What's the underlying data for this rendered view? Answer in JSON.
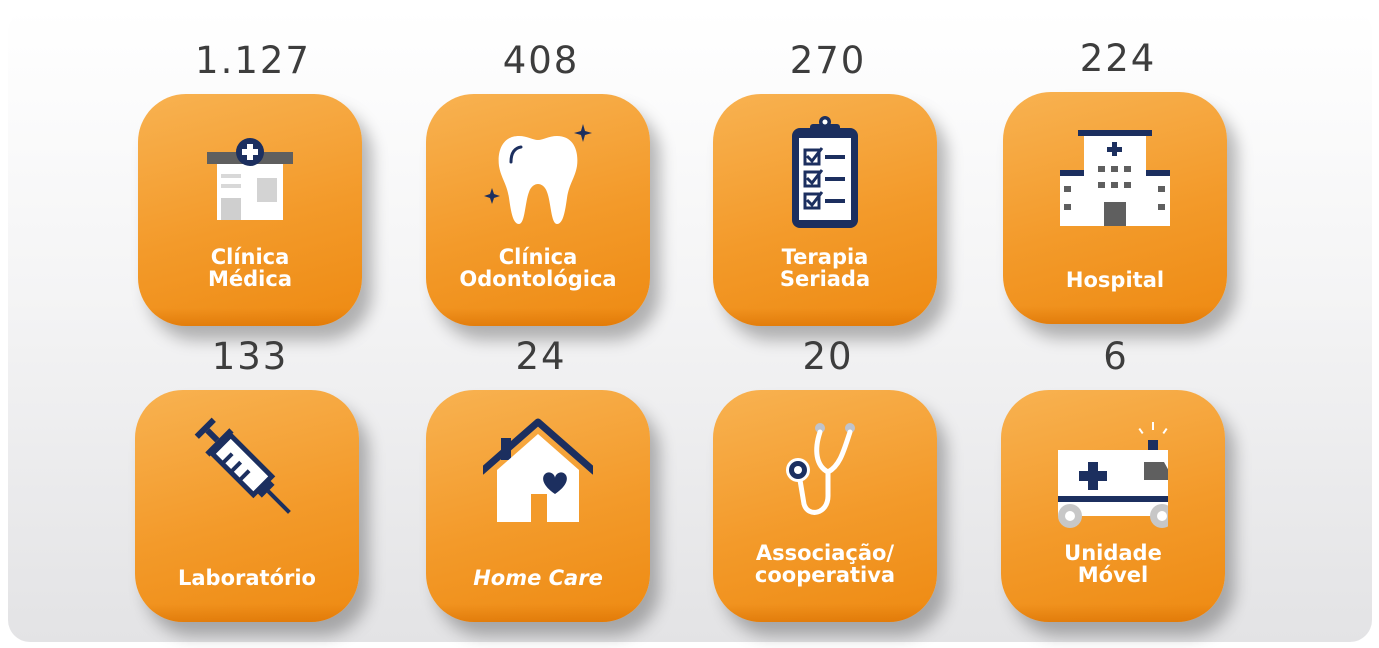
{
  "colors": {
    "tile_orange": "#f39a2a",
    "icon_navy": "#1c2f5f",
    "icon_white": "#ffffff",
    "count_text": "#3d3d3d"
  },
  "cards": [
    {
      "count": "1.127",
      "label": "Clínica\nMédica",
      "icon": "clinic-building-icon"
    },
    {
      "count": "408",
      "label": "Clínica\nOdontológica",
      "icon": "tooth-icon"
    },
    {
      "count": "270",
      "label": "Terapia\nSeriada",
      "icon": "clipboard-checklist-icon"
    },
    {
      "count": "224",
      "label": "Hospital",
      "icon": "hospital-icon"
    },
    {
      "count": "133",
      "label": "Laboratório",
      "icon": "syringe-icon"
    },
    {
      "count": "24",
      "label": "Home Care",
      "icon": "house-heart-icon"
    },
    {
      "count": "20",
      "label": "Associação/\ncooperativa",
      "icon": "stethoscope-icon"
    },
    {
      "count": "6",
      "label": "Unidade\nMóvel",
      "icon": "ambulance-icon"
    }
  ]
}
